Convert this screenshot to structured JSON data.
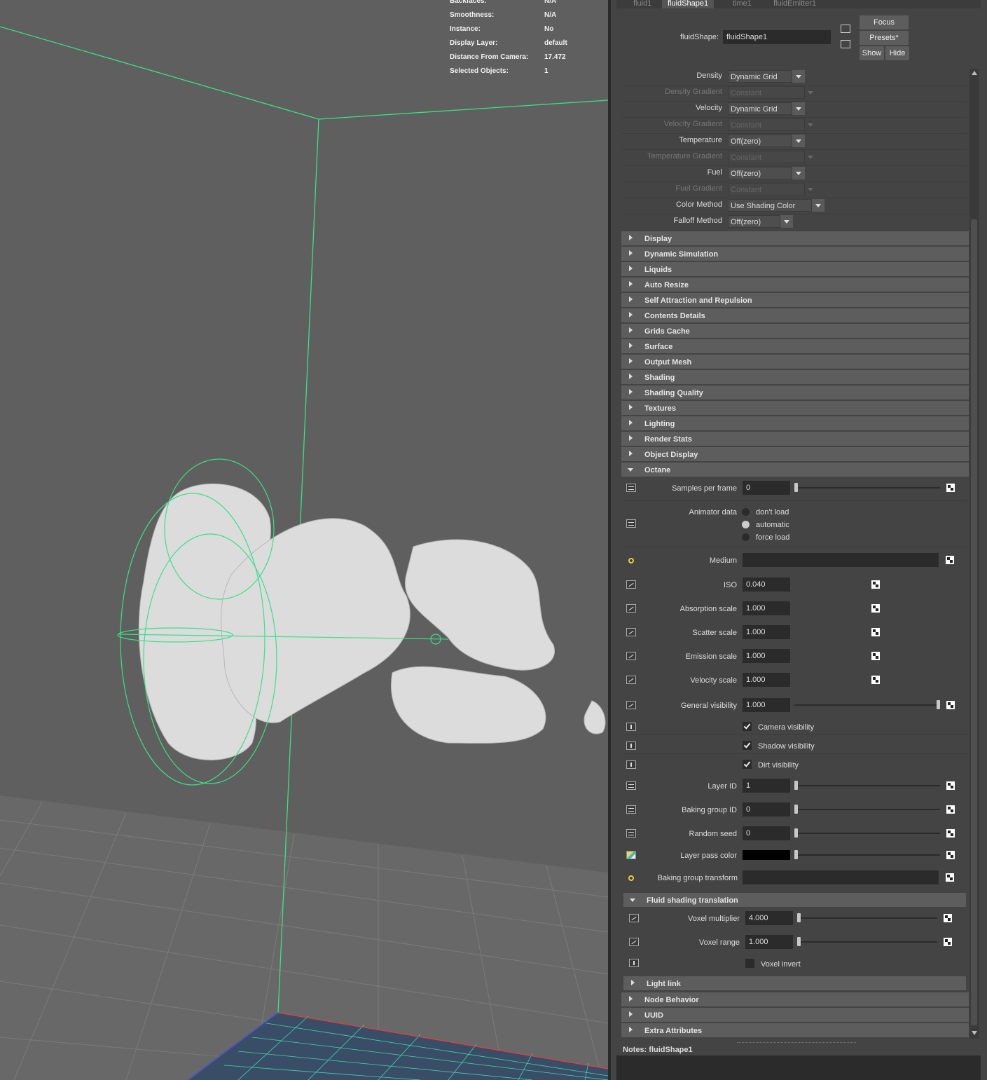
{
  "hud": [
    {
      "label": "Backfaces:",
      "value": "N/A"
    },
    {
      "label": "Smoothness:",
      "value": "N/A"
    },
    {
      "label": "Instance:",
      "value": "No"
    },
    {
      "label": "Display Layer:",
      "value": "default"
    },
    {
      "label": "Distance From Camera:",
      "value": "17.472"
    },
    {
      "label": "Selected Objects:",
      "value": "1"
    }
  ],
  "tabs": [
    "fluid1",
    "fluidShape1",
    "time1",
    "fluidEmitter1"
  ],
  "header": {
    "node_label": "fluidShape:",
    "node_value": "fluidShape1",
    "focus": "Focus",
    "presets": "Presets*",
    "show": "Show",
    "hide": "Hide"
  },
  "contents": [
    {
      "label": "Density",
      "value": "Dynamic Grid",
      "dim": false
    },
    {
      "label": "Density Gradient",
      "value": "Constant",
      "dim": true
    },
    {
      "label": "Velocity",
      "value": "Dynamic Grid",
      "dim": false
    },
    {
      "label": "Velocity Gradient",
      "value": "Constant",
      "dim": true
    },
    {
      "label": "Temperature",
      "value": "Off(zero)",
      "dim": false
    },
    {
      "label": "Temperature Gradient",
      "value": "Constant",
      "dim": true
    },
    {
      "label": "Fuel",
      "value": "Off(zero)",
      "dim": false
    },
    {
      "label": "Fuel Gradient",
      "value": "Constant",
      "dim": true
    },
    {
      "label": "Color Method",
      "value": "Use Shading Color",
      "dim": false
    },
    {
      "label": "Falloff Method",
      "value": "Off(zero)",
      "dim": false
    }
  ],
  "sections": [
    "Display",
    "Dynamic Simulation",
    "Liquids",
    "Auto Resize",
    "Self Attraction and Repulsion",
    "Contents Details",
    "Grids Cache",
    "Surface",
    "Output Mesh",
    "Shading",
    "Shading Quality",
    "Textures",
    "Lighting",
    "Render Stats",
    "Object Display"
  ],
  "octane": {
    "title": "Octane",
    "samples_per_frame": {
      "label": "Samples per frame",
      "value": "0"
    },
    "animator_data": {
      "label": "Animator data",
      "options": [
        "don't load",
        "automatic",
        "force load"
      ],
      "selected": "automatic"
    },
    "medium": {
      "label": "Medium",
      "value": ""
    },
    "iso": {
      "label": "ISO",
      "value": "0.040"
    },
    "absorption": {
      "label": "Absorption scale",
      "value": "1.000"
    },
    "scatter": {
      "label": "Scatter scale",
      "value": "1.000"
    },
    "emission": {
      "label": "Emission scale",
      "value": "1.000"
    },
    "velocity": {
      "label": "Velocity scale",
      "value": "1.000"
    },
    "general_visibility": {
      "label": "General visibility",
      "value": "1.000",
      "level": 1.0
    },
    "camera_visibility": {
      "label": "Camera visibility",
      "checked": true
    },
    "shadow_visibility": {
      "label": "Shadow visibility",
      "checked": true
    },
    "dirt_visibility": {
      "label": "Dirt visibility",
      "checked": true
    },
    "layer_id": {
      "label": "Layer ID",
      "value": "1"
    },
    "baking_group_id": {
      "label": "Baking group ID",
      "value": "0"
    },
    "random_seed": {
      "label": "Random seed",
      "value": "0"
    },
    "layer_pass_color": {
      "label": "Layer pass color",
      "color": "#000000"
    },
    "baking_group_transform": {
      "label": "Baking group transform",
      "value": ""
    },
    "fluid_shading": {
      "title": "Fluid shading translation",
      "voxel_multiplier": {
        "label": "Voxel multiplier",
        "value": "4.000"
      },
      "voxel_range": {
        "label": "Voxel range",
        "value": "1.000"
      },
      "voxel_invert": {
        "label": "Voxel invert",
        "checked": false
      }
    },
    "light_link": "Light link"
  },
  "tail_sections": [
    "Node Behavior",
    "UUID",
    "Extra Attributes"
  ],
  "notes": {
    "label": "Notes:",
    "value": "fluidShape1"
  },
  "colors": {
    "accent_green": "#39e08c",
    "viewport_bg": "#5f5f5f",
    "panel_bg": "#444444"
  }
}
